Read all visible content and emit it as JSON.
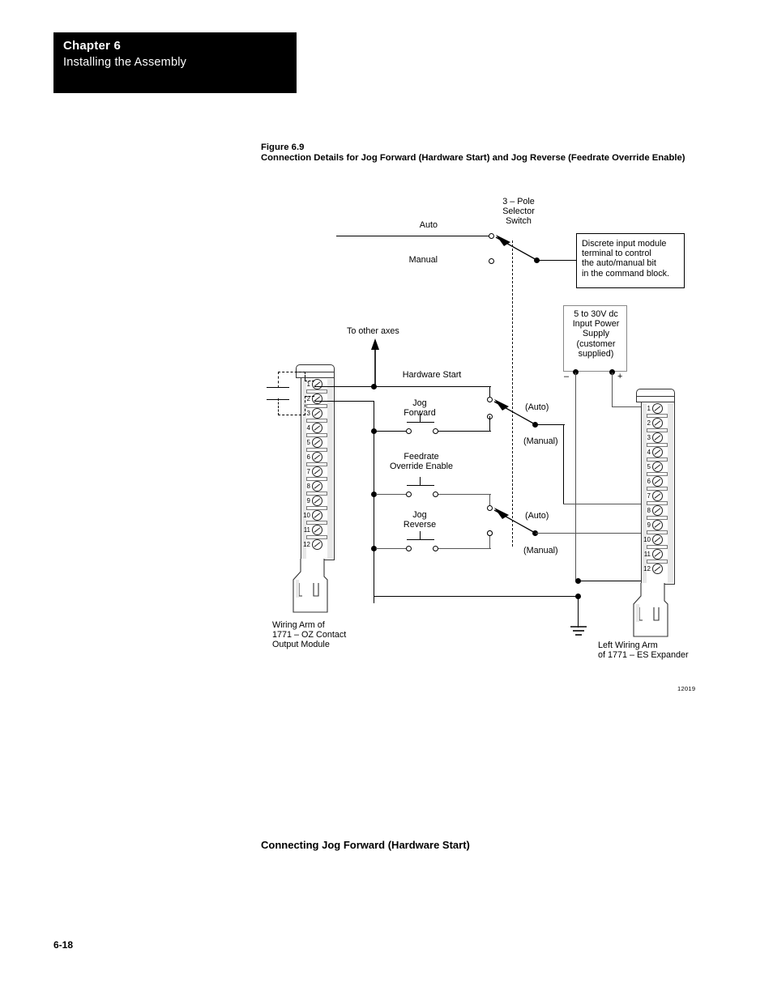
{
  "chapter": {
    "number": "Chapter 6",
    "title": "Installing the Assembly"
  },
  "figure": {
    "number": "Figure 6.9",
    "caption": "Connection Details for Jog Forward (Hardware Start) and Jog Reverse (Feedrate Override Enable)",
    "id_code": "12019"
  },
  "diagram": {
    "selector_switch_label": "3 – Pole\nSelector\nSwitch",
    "auto_label": "Auto",
    "manual_label": "Manual",
    "callout_note": "Discrete input module\nterminal to control\nthe auto/manual bit\nin the command block.",
    "power_supply": "5 to 30V dc\nInput Power\nSupply\n(customer\nsupplied)",
    "power_minus": "–",
    "power_plus": "+",
    "to_other_axes": "To other axes",
    "rungs": [
      {
        "name": "Hardware Start",
        "label": "Hardware Start"
      },
      {
        "name": "Jog Forward",
        "label": "Jog\nForward"
      },
      {
        "name": "Feedrate Override Enable",
        "label": "Feedrate\nOverride Enable"
      },
      {
        "name": "Jog Reverse",
        "label": "Jog\nReverse"
      }
    ],
    "pole_labels": [
      {
        "auto": "(Auto)",
        "manual": "(Manual)"
      },
      {
        "auto": "(Auto)",
        "manual": "(Manual)"
      }
    ],
    "left_module_caption": "Wiring Arm of\n1771 – OZ Contact\nOutput Module",
    "right_module_caption": "Left Wiring Arm\nof 1771 – ES Expander",
    "terminal_numbers": [
      "1",
      "2",
      "3",
      "4",
      "5",
      "6",
      "7",
      "8",
      "9",
      "10",
      "11",
      "12"
    ]
  },
  "section": {
    "heading": "Connecting Jog Forward (Hardware Start)"
  },
  "footer": {
    "page_number": "6-18"
  }
}
